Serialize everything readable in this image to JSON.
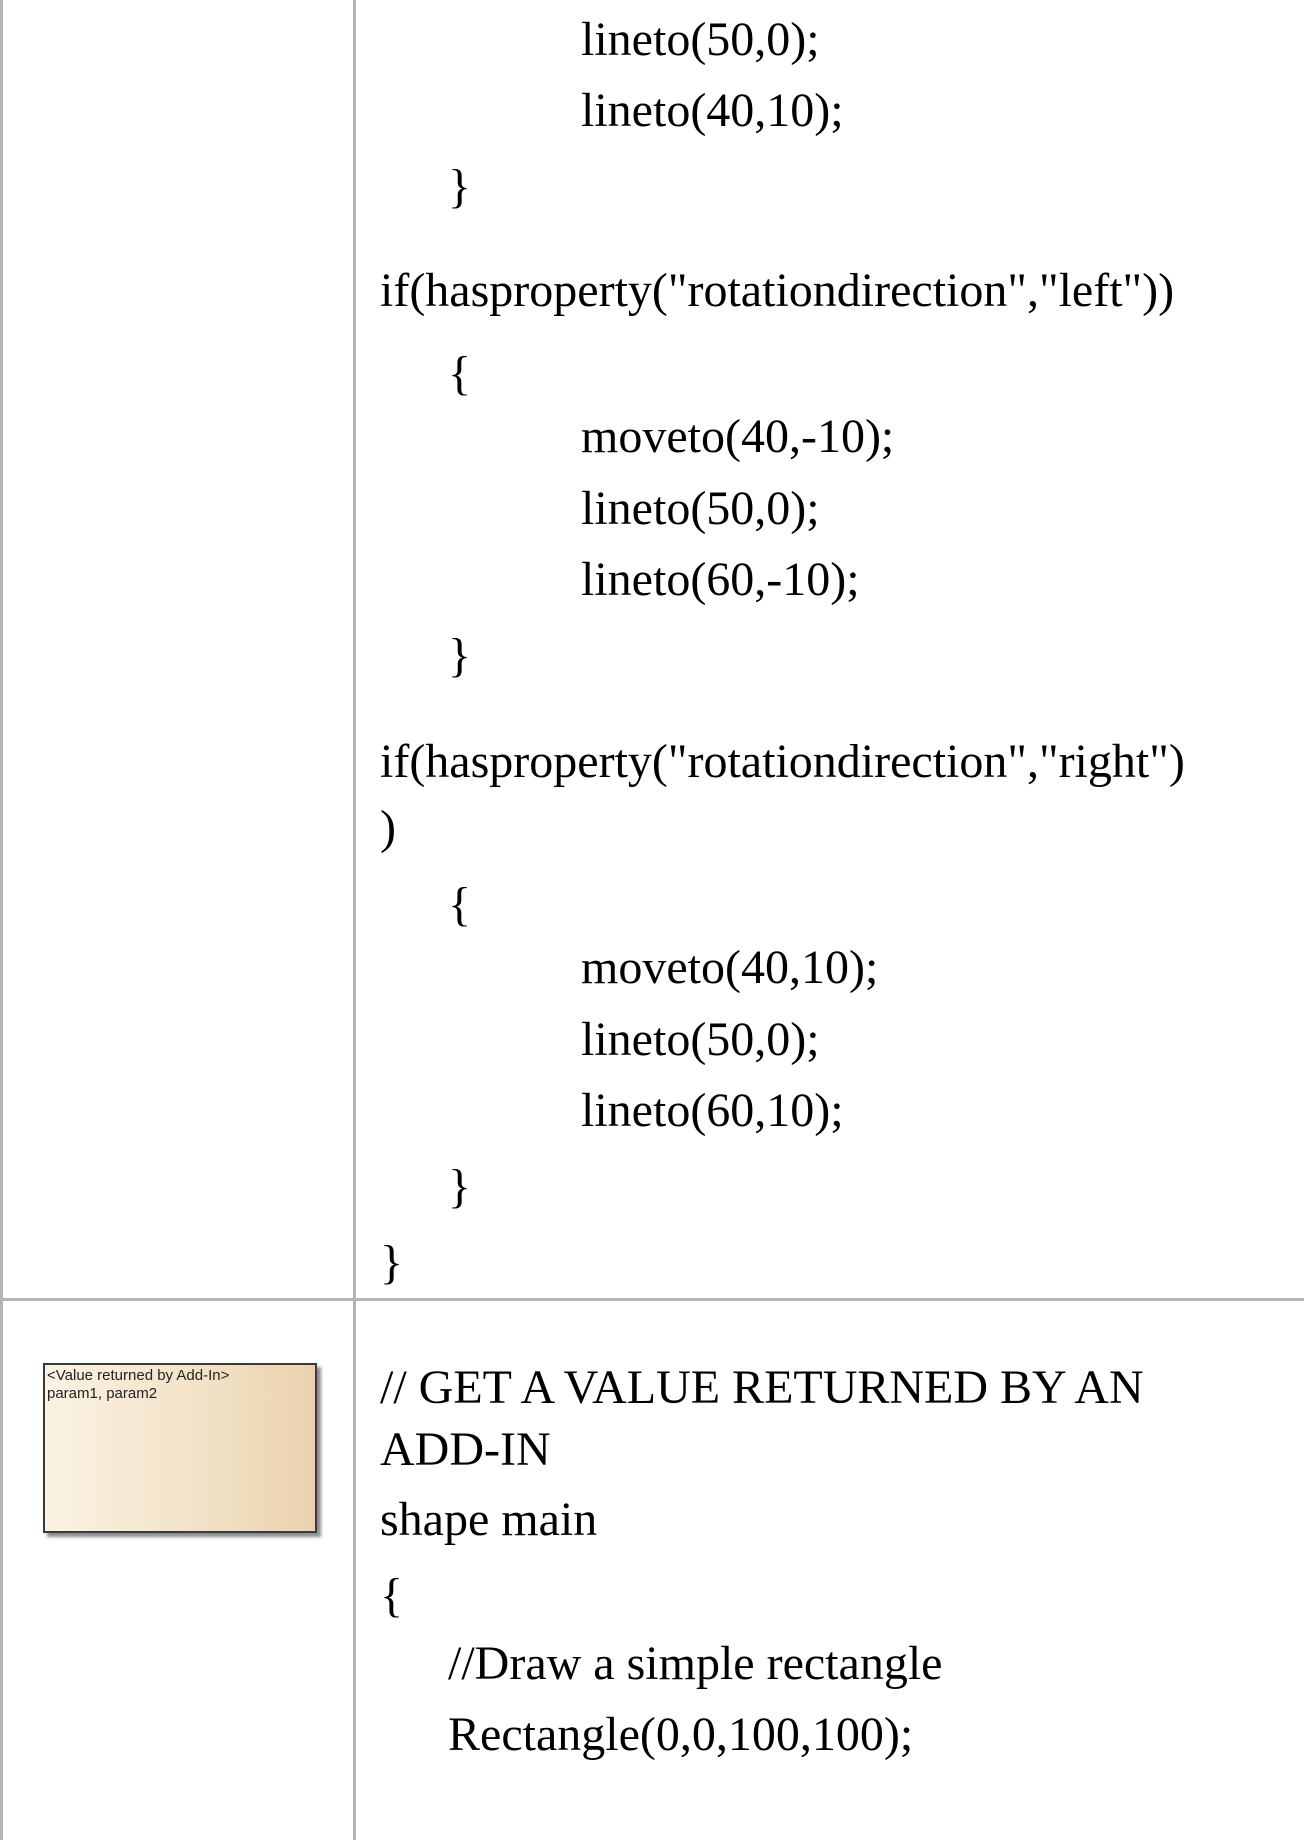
{
  "row1": {
    "code": [
      "lineto(50,0);",
      "lineto(40,10);",
      "}",
      "if(hasproperty(\"rotationdirection\",\"left\"))",
      "{",
      "moveto(40,-10);",
      "lineto(50,0);",
      "lineto(60,-10);",
      "}",
      "if(hasproperty(\"rotationdirection\",\"right\")",
      ")",
      "{",
      "moveto(40,10);",
      "lineto(50,0);",
      "lineto(60,10);",
      "}",
      "}"
    ]
  },
  "row2": {
    "thumbnail": {
      "line1": "<Value returned by Add-In>",
      "line2": "param1, param2"
    },
    "code": [
      "// GET A VALUE RETURNED BY AN",
      "ADD-IN",
      "shape main",
      "{",
      "//Draw a simple rectangle",
      "Rectangle(0,0,100,100);"
    ]
  }
}
